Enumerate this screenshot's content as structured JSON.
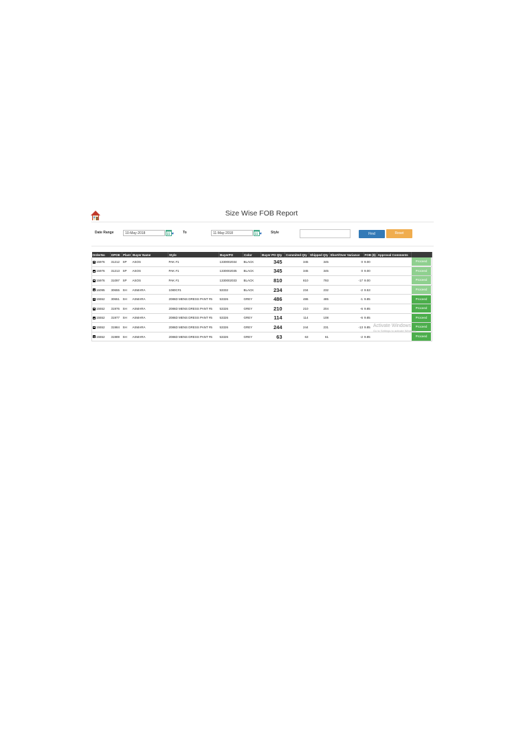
{
  "header": {
    "title": "Size Wise FOB Report"
  },
  "icons": {
    "home": "home-icon",
    "calendar": "calendar-icon",
    "expand": "expand-icon"
  },
  "filters": {
    "date_range_label": "Date Range",
    "from_date": "10-May-2018",
    "to_label": "To",
    "to_date": "11-May-2018",
    "style_label": "Style",
    "style_value": "",
    "find_label": "Find",
    "reset_label": "Reset"
  },
  "colors": {
    "header_bg": "#3a3a3a",
    "find": "#337ab7",
    "reset": "#f0ad4e",
    "status_light": "#8fd08f",
    "status_dark": "#4cae4c"
  },
  "table": {
    "columns": [
      "OrderNo",
      "DPOE",
      "Plant",
      "Buyer Name",
      "Style",
      "BuyerPO",
      "Color",
      "Buyer PO Qty",
      "Commited Qty",
      "Shipped Qty",
      "Short/Over Variance",
      "FOB ($)",
      "Approval Comments",
      ""
    ],
    "rows": [
      {
        "order": "15976",
        "dpoe": "31212",
        "plant": "SP",
        "buyer": "ASOS",
        "style": "PAK #1",
        "po": "1330002034",
        "color": "BLACK",
        "po_qty": "345",
        "committed": "345",
        "shipped": "345",
        "variance": "0",
        "fob": "9.00",
        "comments": "",
        "status": "Proceed",
        "tone": "light"
      },
      {
        "order": "15976",
        "dpoe": "31213",
        "plant": "SP",
        "buyer": "ASOS",
        "style": "PAK #1",
        "po": "1330002035",
        "color": "BLACK",
        "po_qty": "345",
        "committed": "345",
        "shipped": "345",
        "variance": "0",
        "fob": "9.00",
        "comments": "",
        "status": "Proceed",
        "tone": "light"
      },
      {
        "order": "15976",
        "dpoe": "31097",
        "plant": "SP",
        "buyer": "ASOS",
        "style": "PAK #1",
        "po": "1330002033",
        "color": "BLACK",
        "po_qty": "810",
        "committed": "810",
        "shipped": "793",
        "variance": "-17",
        "fob": "9.00",
        "comments": "",
        "status": "Proceed",
        "tone": "light"
      },
      {
        "order": "16095",
        "dpoe": "30655",
        "plant": "SH",
        "buyer": "ASMARA",
        "style": "1080C#1",
        "po": "53332",
        "color": "BLACK",
        "po_qty": "234",
        "committed": "234",
        "shipped": "232",
        "variance": "-2",
        "fob": "9.53",
        "comments": "",
        "status": "Proceed",
        "tone": "light"
      },
      {
        "order": "15552",
        "dpoe": "30651",
        "plant": "SH",
        "buyer": "ASMARA",
        "style": "2086D MENS DRESS PANT #5",
        "po": "53326",
        "color": "GREY",
        "po_qty": "486",
        "committed": "486",
        "shipped": "485",
        "variance": "-1",
        "fob": "9.85",
        "comments": "",
        "status": "Proceed",
        "tone": "dark"
      },
      {
        "order": "15552",
        "dpoe": "31976",
        "plant": "SH",
        "buyer": "ASMARA",
        "style": "2086D MENS DRESS PANT #5",
        "po": "53326",
        "color": "GREY",
        "po_qty": "210",
        "committed": "210",
        "shipped": "204",
        "variance": "-6",
        "fob": "9.85",
        "comments": "",
        "status": "Proceed",
        "tone": "dark"
      },
      {
        "order": "15552",
        "dpoe": "31977",
        "plant": "SH",
        "buyer": "ASMARA",
        "style": "2086D MENS DRESS PANT #5",
        "po": "53326",
        "color": "GREY",
        "po_qty": "114",
        "committed": "114",
        "shipped": "108",
        "variance": "-6",
        "fob": "9.85",
        "comments": "",
        "status": "Proceed",
        "tone": "dark"
      },
      {
        "order": "15552",
        "dpoe": "31984",
        "plant": "SH",
        "buyer": "ASMARA",
        "style": "2086D MENS DRESS PANT #5",
        "po": "53326",
        "color": "GREY",
        "po_qty": "244",
        "committed": "244",
        "shipped": "231",
        "variance": "-13",
        "fob": "9.85",
        "comments": "",
        "status": "Proceed",
        "tone": "dark"
      },
      {
        "order": "15552",
        "dpoe": "31989",
        "plant": "SH",
        "buyer": "ASMARA",
        "style": "2086D MENS DRESS PANT #5",
        "po": "53326",
        "color": "GREY",
        "po_qty": "63",
        "committed": "63",
        "shipped": "61",
        "variance": "-2",
        "fob": "9.85",
        "comments": "",
        "status": "Proceed",
        "tone": "dark"
      }
    ]
  },
  "watermark": {
    "title": "Activate Windows",
    "subtitle": "Go to Settings to activate Windows."
  }
}
